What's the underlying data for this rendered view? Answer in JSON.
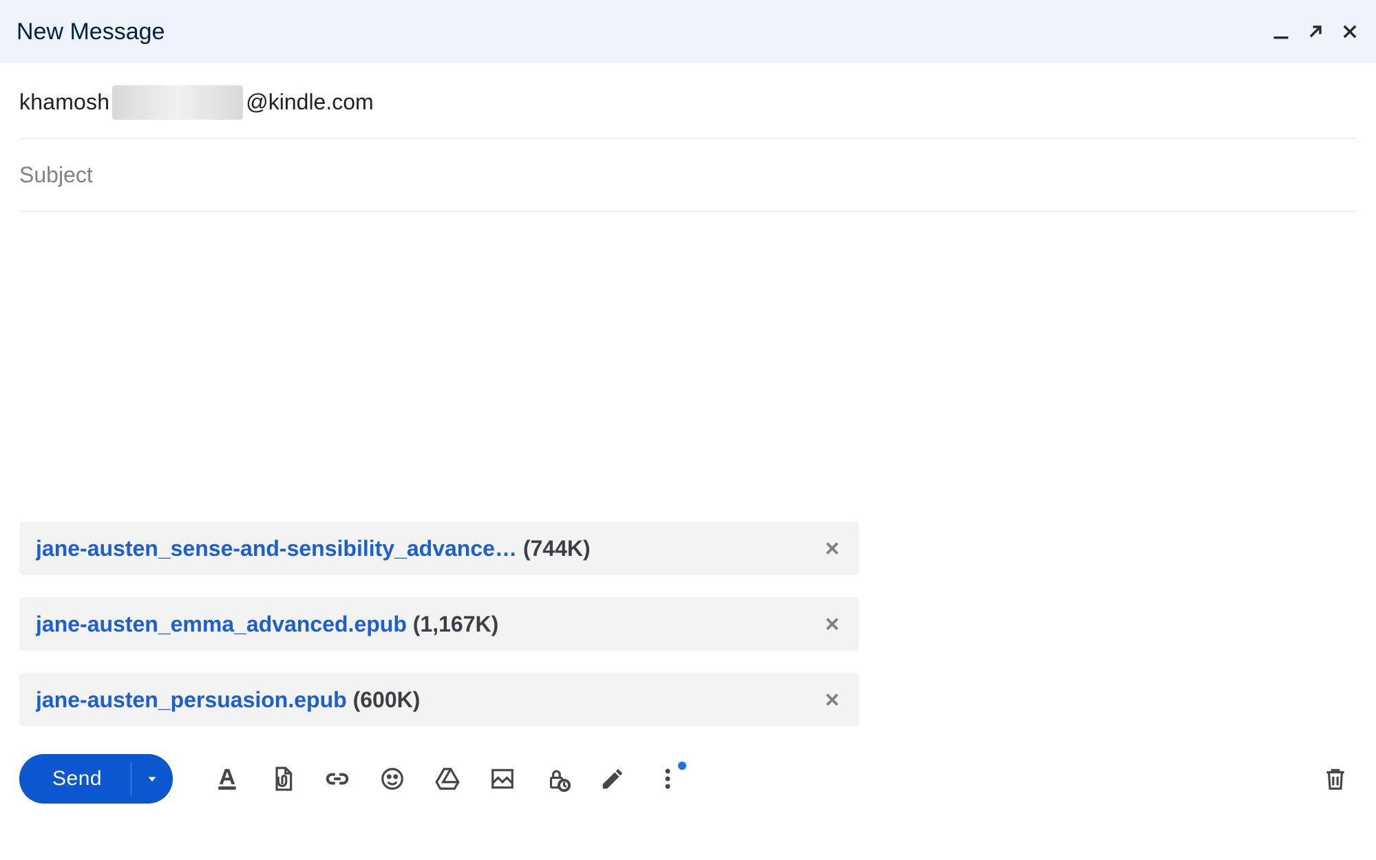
{
  "header": {
    "title": "New Message"
  },
  "compose": {
    "to_prefix": "khamosh",
    "to_suffix": "@kindle.com",
    "subject_placeholder": "Subject"
  },
  "attachments": [
    {
      "filename": "jane-austen_sense-and-sensibility_advance…",
      "size": "(744K)"
    },
    {
      "filename": "jane-austen_emma_advanced.epub",
      "size": "(1,167K)"
    },
    {
      "filename": "jane-austen_persuasion.epub",
      "size": "(600K)"
    }
  ],
  "toolbar": {
    "send_label": "Send"
  }
}
